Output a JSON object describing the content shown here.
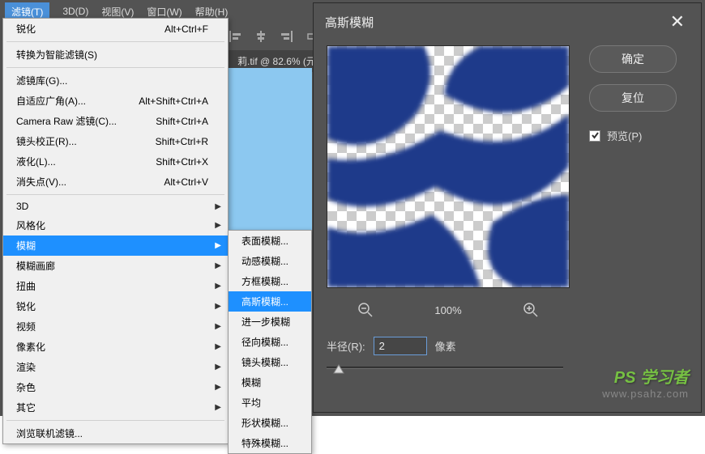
{
  "menubar": {
    "filter": "滤镜(T)",
    "three_d": "3D(D)",
    "view": "视图(V)",
    "window": "窗口(W)",
    "help": "帮助(H)"
  },
  "doc_tab": "莉.tif @ 82.6% (元",
  "filter_menu": {
    "sharpen": "锐化",
    "sharpen_sc": "Alt+Ctrl+F",
    "smart": "转换为智能滤镜(S)",
    "gallery": "滤镜库(G)...",
    "adaptive": "自适应广角(A)...",
    "adaptive_sc": "Alt+Shift+Ctrl+A",
    "camera_raw": "Camera Raw 滤镜(C)...",
    "camera_raw_sc": "Shift+Ctrl+A",
    "lens": "镜头校正(R)...",
    "lens_sc": "Shift+Ctrl+R",
    "liquify": "液化(L)...",
    "liquify_sc": "Shift+Ctrl+X",
    "vanish": "消失点(V)...",
    "vanish_sc": "Alt+Ctrl+V",
    "three_d": "3D",
    "stylize": "风格化",
    "blur": "模糊",
    "blur_gallery": "模糊画廊",
    "distort": "扭曲",
    "sharpen2": "锐化",
    "video": "视频",
    "pixelate": "像素化",
    "render": "渲染",
    "noise": "杂色",
    "other": "其它",
    "browse": "浏览联机滤镜..."
  },
  "blur_submenu": {
    "surface": "表面模糊...",
    "motion": "动感模糊...",
    "box": "方框模糊...",
    "gaussian": "高斯模糊...",
    "further": "进一步模糊",
    "radial": "径向模糊...",
    "lens": "镜头模糊...",
    "blur": "模糊",
    "average": "平均",
    "shape": "形状模糊...",
    "special": "特殊模糊..."
  },
  "dialog": {
    "title": "高斯模糊",
    "ok": "确定",
    "reset": "复位",
    "preview": "预览(P)",
    "zoom": "100%",
    "radius_label": "半径(R):",
    "radius_value": "2",
    "radius_unit": "像素"
  },
  "watermark": {
    "l1": "PS 学习者",
    "l2": "www.psahz.com"
  }
}
